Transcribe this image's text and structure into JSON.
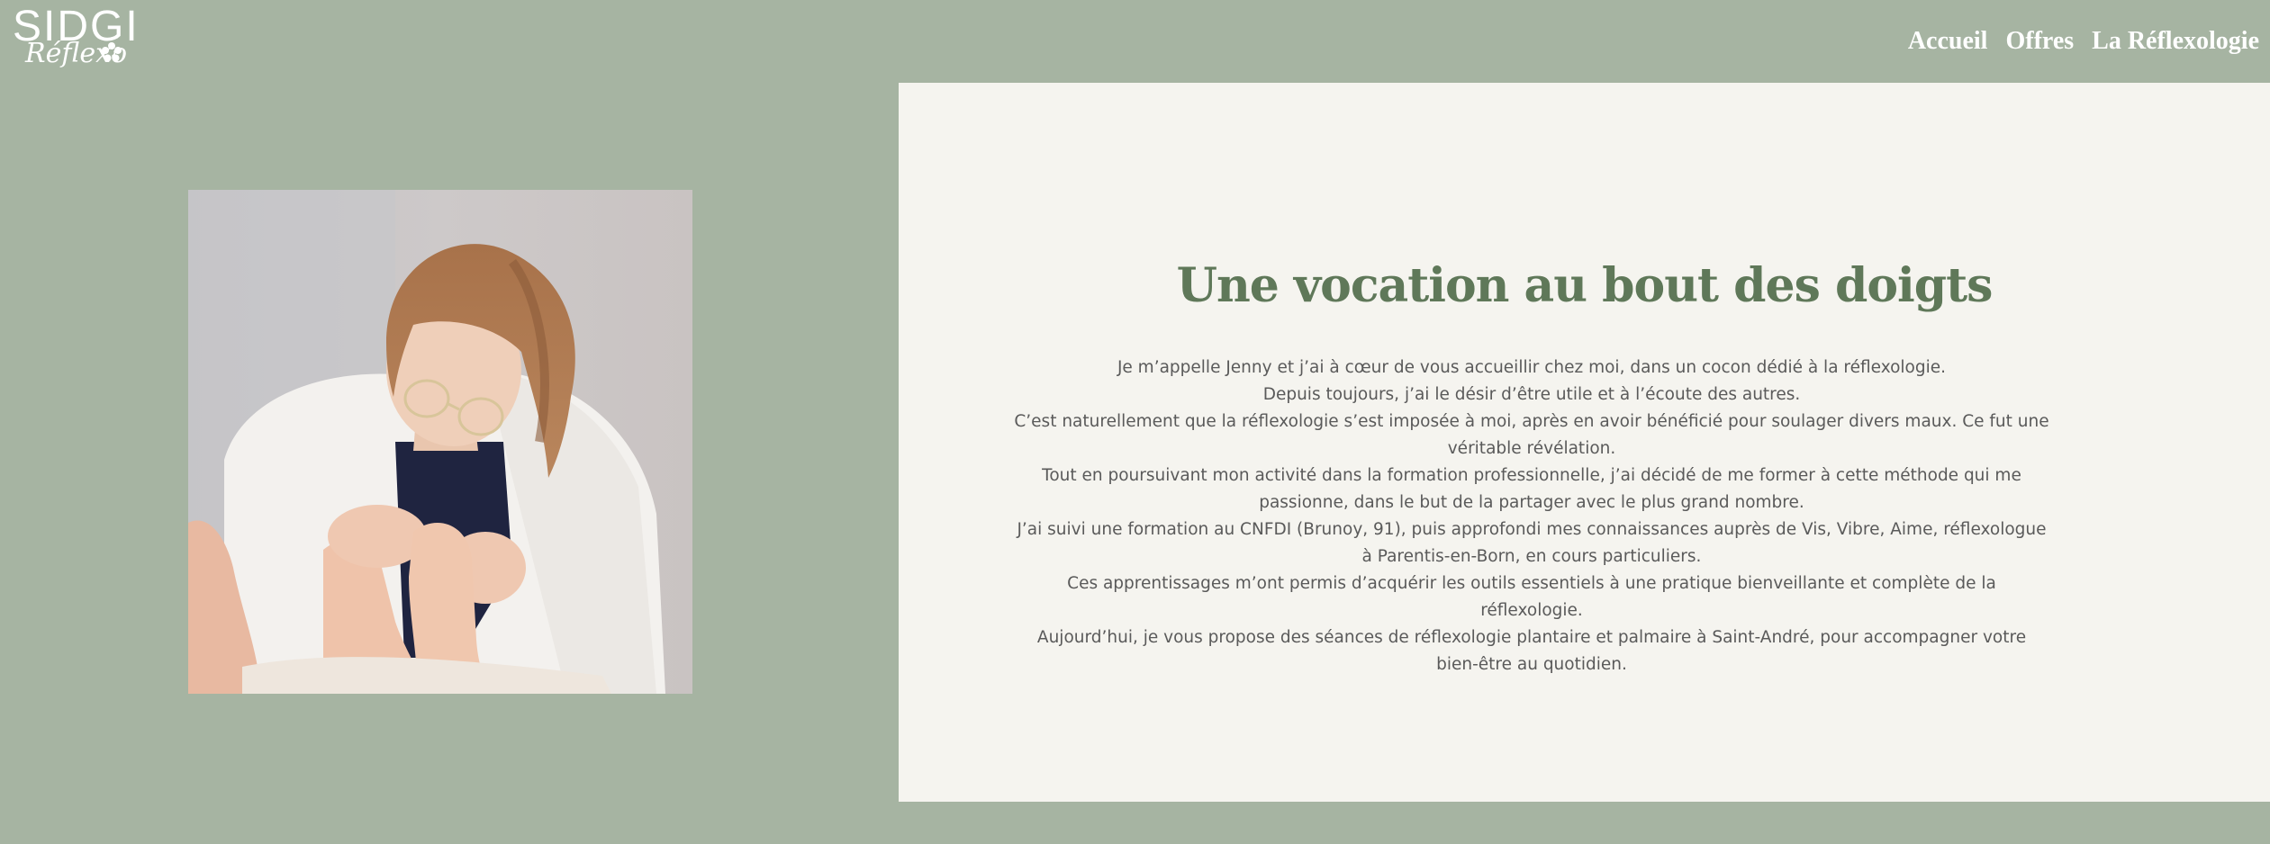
{
  "header": {
    "logo_main": "SIDGI",
    "logo_sub": "Réflexo",
    "nav": [
      {
        "label": "Accueil"
      },
      {
        "label": "Offres"
      },
      {
        "label": "La Réflexologie"
      }
    ]
  },
  "main": {
    "title": "Une vocation au bout des doigts",
    "paragraphs": [
      "Je m’appelle Jenny et j’ai à cœur de vous accueillir chez moi, dans un cocon dédié à la réflexologie.",
      "Depuis toujours, j’ai le désir d’être utile et à l’écoute des autres.",
      "C’est naturellement que la réflexologie s’est imposée à moi, après en avoir bénéficié pour soulager divers maux. Ce fut une véritable révélation.",
      "Tout en poursuivant mon activité dans la formation professionnelle, j’ai décidé de me former à cette méthode qui me passionne, dans le but de la partager avec le plus grand nombre.",
      "J’ai suivi une formation au CNFDI (Brunoy, 91), puis approfondi mes connaissances auprès de Vis, Vibre, Aime, réflexologue à Parentis-en-Born, en cours particuliers.",
      "Ces apprentissages m’ont permis d’acquérir les outils essentiels à une pratique bienveillante et complète de la réflexologie.",
      "Aujourd’hui, je vous propose des séances de réflexologie plantaire et palmaire à Saint-André, pour accompagner votre bien-être au quotidien."
    ]
  },
  "colors": {
    "background": "#a6b4a2",
    "card": "#f5f4ef",
    "title": "#5f7859",
    "body_text": "#5a5a5a"
  },
  "icons": {
    "logo_flower": "flower-icon"
  }
}
